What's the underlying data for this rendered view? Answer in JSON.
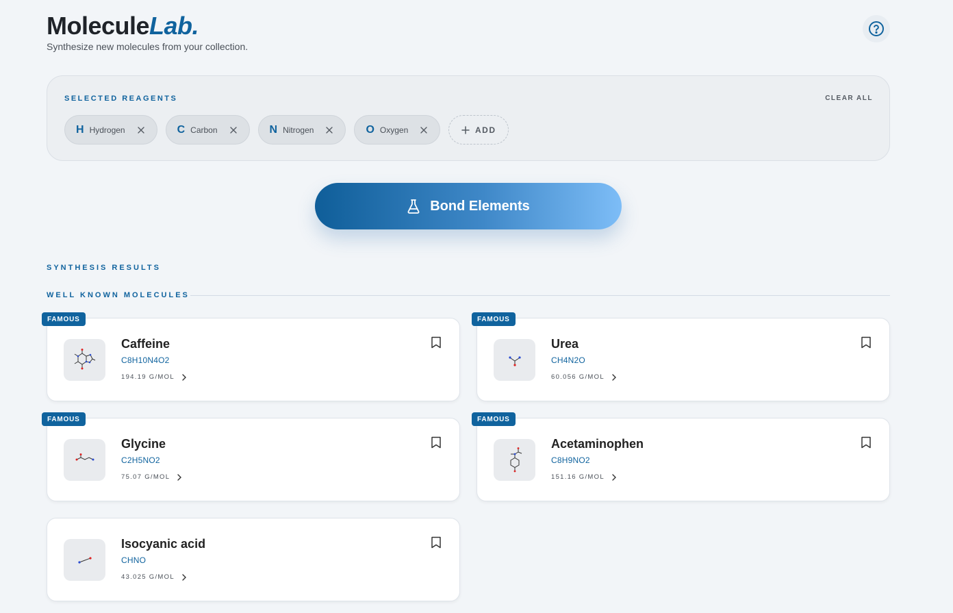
{
  "header": {
    "brand_main": "Molecule",
    "brand_accent": "Lab.",
    "tagline": "Synthesize new molecules from your collection."
  },
  "reagents": {
    "title": "SELECTED REAGENTS",
    "clear_label": "CLEAR ALL",
    "items": [
      {
        "symbol": "H",
        "name": "Hydrogen"
      },
      {
        "symbol": "C",
        "name": "Carbon"
      },
      {
        "symbol": "N",
        "name": "Nitrogen"
      },
      {
        "symbol": "O",
        "name": "Oxygen"
      }
    ],
    "add_label": "ADD"
  },
  "bond_button": {
    "label": "Bond Elements"
  },
  "sections": {
    "results": "SYNTHESIS RESULTS",
    "well_known": "WELL KNOWN MOLECULES"
  },
  "molecules": [
    {
      "name": "Caffeine",
      "formula": "C8H10N4O2",
      "weight": "194.19 G/MOL",
      "badge": "FAMOUS"
    },
    {
      "name": "Urea",
      "formula": "CH4N2O",
      "weight": "60.056 G/MOL",
      "badge": "FAMOUS"
    },
    {
      "name": "Glycine",
      "formula": "C2H5NO2",
      "weight": "75.07 G/MOL",
      "badge": "FAMOUS"
    },
    {
      "name": "Acetaminophen",
      "formula": "C8H9NO2",
      "weight": "151.16 G/MOL",
      "badge": "FAMOUS"
    },
    {
      "name": "Isocyanic acid",
      "formula": "CHNO",
      "weight": "43.025 G/MOL"
    }
  ],
  "colors": {
    "accent": "#10639e",
    "background": "#f2f5f8",
    "gradient_start": "#0f5e99",
    "gradient_end": "#7dbdf7"
  }
}
